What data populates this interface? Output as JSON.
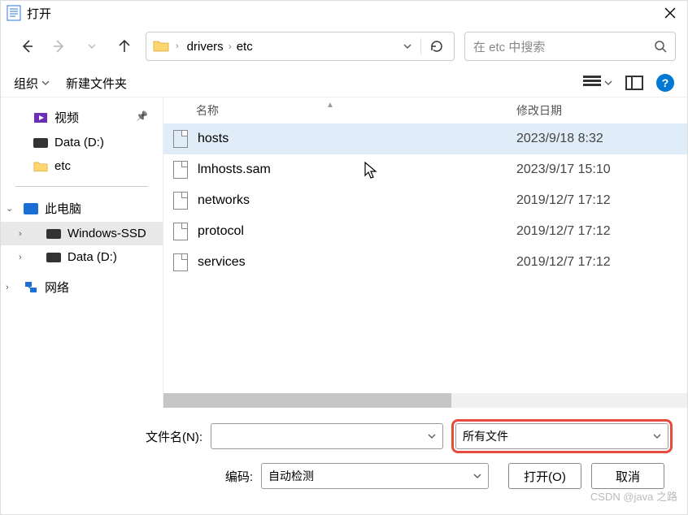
{
  "window": {
    "title": "打开"
  },
  "nav": {
    "crumbs": [
      "drivers",
      "etc"
    ],
    "search_placeholder": "在 etc 中搜索"
  },
  "toolbar": {
    "organize": "组织",
    "newfolder": "新建文件夹"
  },
  "sidebar": {
    "video": "视频",
    "data_d": "Data (D:)",
    "etc": "etc",
    "this_pc": "此电脑",
    "windows_ssd": "Windows-SSD",
    "data_d2": "Data (D:)",
    "network": "网络"
  },
  "columns": {
    "name": "名称",
    "date": "修改日期"
  },
  "files": [
    {
      "name": "hosts",
      "date": "2023/9/18 8:32"
    },
    {
      "name": "lmhosts.sam",
      "date": "2023/9/17 15:10"
    },
    {
      "name": "networks",
      "date": "2019/12/7 17:12"
    },
    {
      "name": "protocol",
      "date": "2019/12/7 17:12"
    },
    {
      "name": "services",
      "date": "2019/12/7 17:12"
    }
  ],
  "bottom": {
    "filename_label": "文件名(N):",
    "filename_value": "",
    "type_value": "所有文件",
    "encoding_label": "编码:",
    "encoding_value": "自动检测",
    "open": "打开(O)",
    "cancel": "取消"
  },
  "watermark": "CSDN @java 之路"
}
